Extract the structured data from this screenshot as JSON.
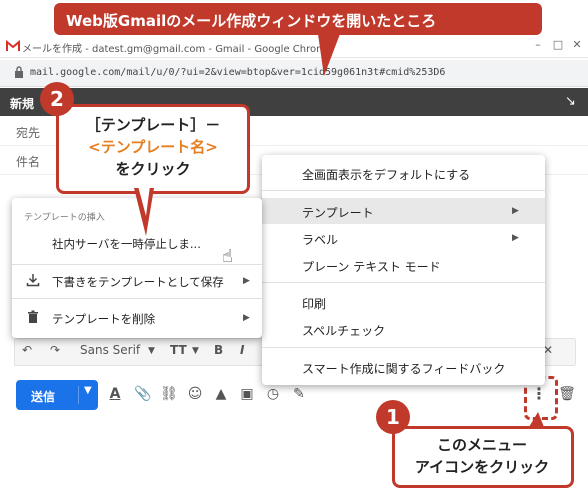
{
  "header_callout": "Web版Gmailのメール作成ウィンドウを開いたところ",
  "chrome": {
    "title": "メールを作成 - datest.gm@gmail.com - Gmail - Google Chrome",
    "url": "mail.google.com/mail/u/0/?ui=2&view=btop&ver=1cid59g061n3t#cmid%253D6"
  },
  "compose": {
    "title": "新規",
    "to_label": "宛先",
    "subject_label": "件名"
  },
  "format_toolbar": {
    "font": "Sans Serif"
  },
  "send_button": "送信",
  "more_menu": {
    "items": [
      "全画面表示をデフォルトにする",
      "テンプレート",
      "ラベル",
      "プレーン テキスト モード",
      "印刷",
      "スペルチェック",
      "スマート作成に関するフィードバック"
    ]
  },
  "template_menu": {
    "header": "テンプレートの挿入",
    "template_name": "社内サーバを一時停止しま...",
    "save_label": "下書きをテンプレートとして保存",
    "delete_label": "テンプレートを削除"
  },
  "annotation_2": {
    "number": "2",
    "line1": "［テンプレート］－",
    "line2": "<テンプレート名>",
    "line3": "をクリック"
  },
  "annotation_1": {
    "number": "1",
    "line1": "このメニュー",
    "line2": "アイコンをクリック"
  },
  "colors": {
    "accent_red": "#c0392b",
    "orange_text": "#e67e22",
    "send_blue": "#1a73e8"
  }
}
